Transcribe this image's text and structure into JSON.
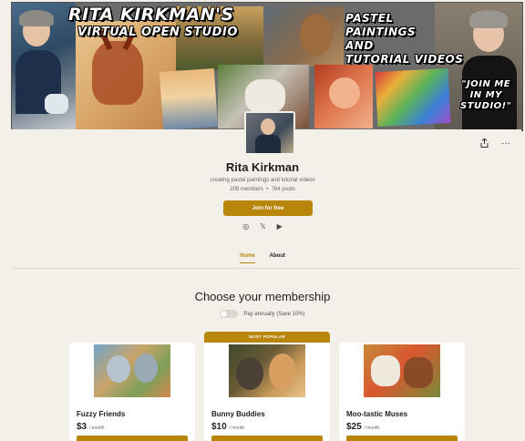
{
  "banner": {
    "title": "RITA KIRKMAN'S",
    "subtitle": "VIRTUAL OPEN STUDIO",
    "right_text": "PASTEL\nPAINTINGS\nAND\nTUTORIAL VIDEOS",
    "bubble_text": "\"JOIN ME\nIN MY\nSTUDIO!\""
  },
  "creator": {
    "name": "Rita Kirkman",
    "tagline": "creating pastel paintings and tutorial videos",
    "members": "209 members",
    "posts": "764 posts",
    "separator": "•"
  },
  "actions": {
    "join_label": "Join for free",
    "share_icon": "share-icon",
    "more_label": "···"
  },
  "socials": {
    "instagram": "◎",
    "x": "𝕏",
    "youtube": "▶"
  },
  "tabs": [
    {
      "label": "Home",
      "active": true
    },
    {
      "label": "About",
      "active": false
    }
  ],
  "membership": {
    "title": "Choose your membership",
    "toggle_label": "Pay annually (Save 10%)",
    "toggle_on": false,
    "tiers": [
      {
        "name": "Fuzzy Friends",
        "price": "$3",
        "period": "/ month",
        "popular": false
      },
      {
        "name": "Bunny Buddies",
        "price": "$10",
        "period": "/ month",
        "popular": true,
        "badge": "MOST POPULAR"
      },
      {
        "name": "Moo-tastic Muses",
        "price": "$25",
        "period": "/ month",
        "popular": false
      }
    ]
  },
  "colors": {
    "accent": "#b8860b",
    "background": "#f3f0ea"
  }
}
